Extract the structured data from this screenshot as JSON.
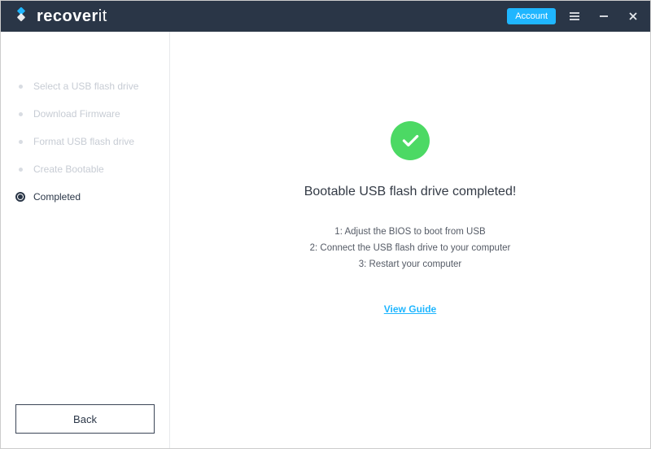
{
  "titlebar": {
    "brand_prefix": "recover",
    "brand_suffix": "it",
    "account_label": "Account"
  },
  "sidebar": {
    "steps": [
      {
        "label": "Select a USB flash drive",
        "active": false
      },
      {
        "label": "Download Firmware",
        "active": false
      },
      {
        "label": "Format USB flash drive",
        "active": false
      },
      {
        "label": "Create Bootable",
        "active": false
      },
      {
        "label": "Completed",
        "active": true
      }
    ],
    "back_label": "Back"
  },
  "content": {
    "title": "Bootable USB flash drive completed!",
    "instructions": [
      "1: Adjust the BIOS to boot from USB",
      "2: Connect the USB flash drive to your computer",
      "3: Restart your computer"
    ],
    "guide_link": "View Guide"
  },
  "colors": {
    "accent": "#1fb6ff",
    "success": "#4cd964",
    "titlebar": "#2a3647"
  }
}
